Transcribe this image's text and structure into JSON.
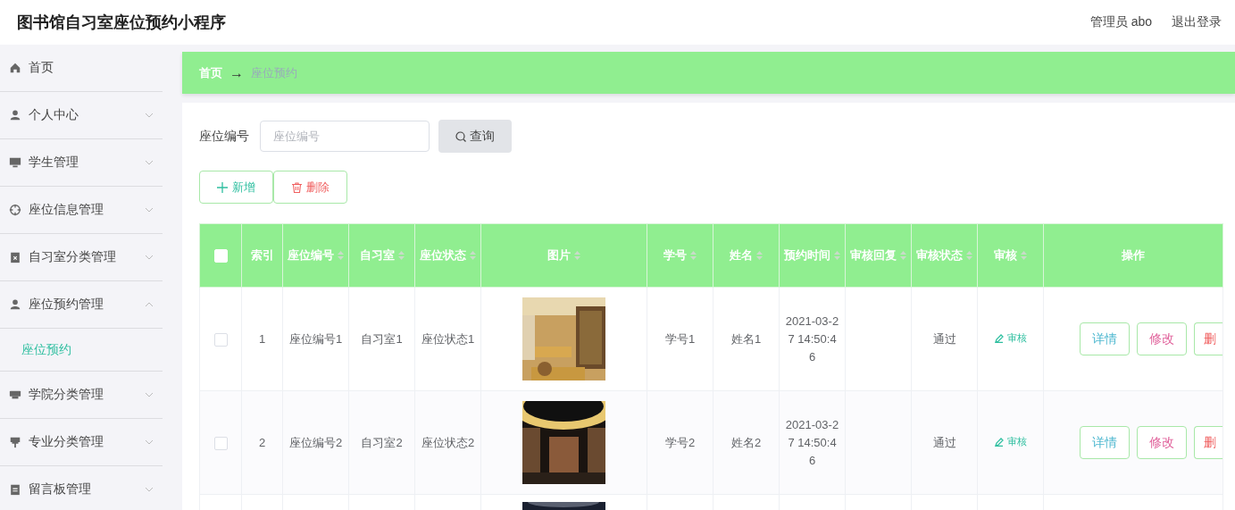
{
  "header": {
    "title": "图书馆自习室座位预约小程序",
    "user": "管理员 abo",
    "logout": "退出登录"
  },
  "sidebar": {
    "items": [
      {
        "label": "首页"
      },
      {
        "label": "个人中心",
        "expanded": false
      },
      {
        "label": "学生管理",
        "expanded": false
      },
      {
        "label": "座位信息管理",
        "expanded": false
      },
      {
        "label": "自习室分类管理",
        "expanded": false
      },
      {
        "label": "座位预约管理",
        "expanded": true,
        "children": [
          {
            "label": "座位预约",
            "selected": true
          }
        ]
      },
      {
        "label": "学院分类管理",
        "expanded": false
      },
      {
        "label": "专业分类管理",
        "expanded": false
      },
      {
        "label": "留言板管理",
        "expanded": false
      }
    ]
  },
  "breadcrumb": [
    "首页",
    "→",
    "座位预约"
  ],
  "search": {
    "label": "座位编号",
    "placeholder": "座位编号",
    "button": "查询"
  },
  "actions": [
    {
      "kind": "add",
      "label": "新增"
    },
    {
      "kind": "delete",
      "label": "删除"
    }
  ],
  "table": {
    "select_all": {
      "checked": false
    },
    "columns": [
      {
        "label": "索引",
        "sortable": false
      },
      {
        "label": "座位编号",
        "sortable": true
      },
      {
        "label": "自习室",
        "sortable": true
      },
      {
        "label": "座位状态",
        "sortable": true
      },
      {
        "label": "图片",
        "sortable": true
      },
      {
        "label": "学号",
        "sortable": true
      },
      {
        "label": "姓名",
        "sortable": true
      },
      {
        "label": "预约时间",
        "sortable": true
      },
      {
        "label": "审核回复",
        "sortable": true
      },
      {
        "label": "审核状态",
        "sortable": true
      },
      {
        "label": "审核",
        "sortable": true
      },
      {
        "label": "操作",
        "sortable": false
      }
    ],
    "rows": [
      {
        "checked": false,
        "cells": [
          "1",
          "座位编号1",
          "自习室1",
          "座位状态1",
          {
            "kind": "picture"
          },
          "学号1",
          "姓名1",
          "2021-03-27 14:50:46",
          "",
          "通过",
          {
            "kind": "review",
            "label": "审核"
          },
          {
            "kind": "ops",
            "buttons": [
              "详情",
              "修改",
              "删"
            ]
          }
        ]
      },
      {
        "checked": false,
        "cells": [
          "2",
          "座位编号2",
          "自习室2",
          "座位状态2",
          {
            "kind": "picture"
          },
          "学号2",
          "姓名2",
          "2021-03-27 14:50:46",
          "",
          "通过",
          {
            "kind": "review",
            "label": "审核"
          },
          {
            "kind": "ops",
            "buttons": [
              "详情",
              "修改",
              "删"
            ]
          }
        ]
      },
      {
        "cells": [
          {
            "kind": "picture"
          }
        ]
      }
    ]
  }
}
